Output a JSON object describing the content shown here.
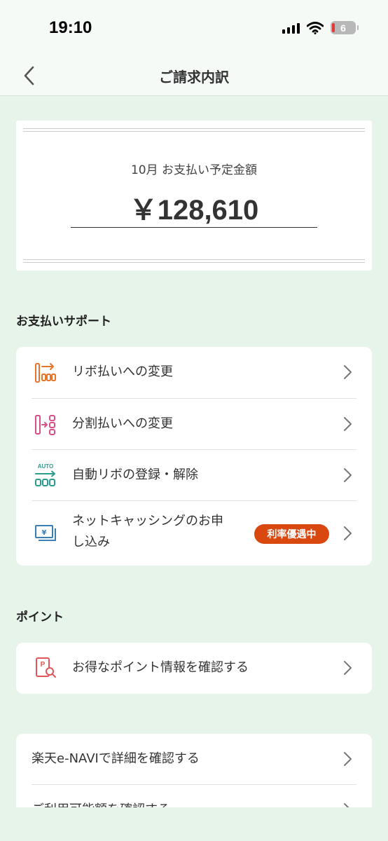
{
  "status_bar": {
    "time": "19:10",
    "battery_level": "6",
    "signal_icon": "signal-bars-icon",
    "wifi_icon": "wifi-icon",
    "battery_icon": "battery-icon"
  },
  "nav": {
    "title": "ご請求内訳",
    "back_icon": "chevron-left-icon"
  },
  "amount": {
    "label": "10月 お支払い予定金額",
    "value": "￥128,610"
  },
  "support": {
    "title": "お支払いサポート",
    "items": [
      {
        "label": "リボ払いへの変更",
        "icon": "revolving-payment-icon",
        "color": "#e8742a"
      },
      {
        "label": "分割払いへの変更",
        "icon": "installment-payment-icon",
        "color": "#d94f8a"
      },
      {
        "label": "自動リボの登録・解除",
        "icon": "auto-revolving-icon",
        "color": "#2e9b8f",
        "icon_text": "AUTO"
      },
      {
        "label": "ネットキャッシングのお申し込み",
        "label_line1": "ネットキャッシングのお申",
        "label_line2": "し込み",
        "icon": "cash-advance-icon",
        "color": "#3b7fb5",
        "badge": "利率優遇中"
      }
    ]
  },
  "points": {
    "title": "ポイント",
    "items": [
      {
        "label": "お得なポイント情報を確認する",
        "icon": "point-search-icon",
        "color": "#e0555a"
      }
    ]
  },
  "links": {
    "items": [
      {
        "label": "楽天e-NAVIで詳細を確認する"
      },
      {
        "label": "ご利用可能額を確認する"
      }
    ]
  },
  "colors": {
    "background": "#e6f4ea",
    "accent_badge": "#d9480f",
    "card": "#ffffff"
  }
}
